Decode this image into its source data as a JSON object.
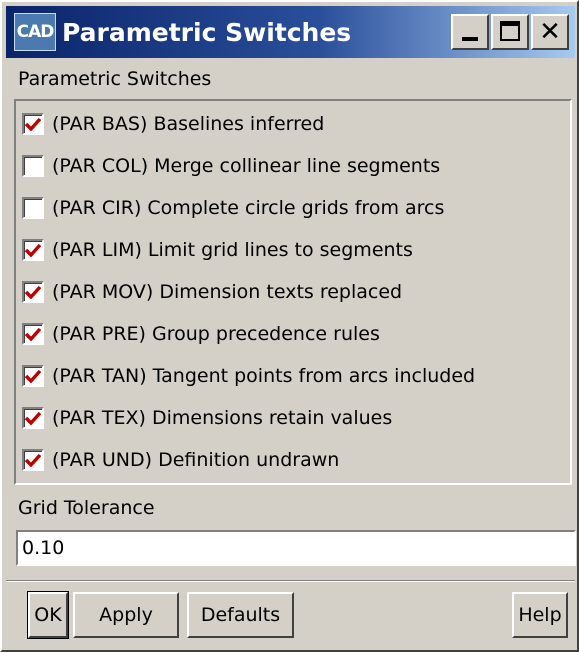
{
  "window": {
    "title": "Parametric Switches",
    "icon": "cad-icon",
    "icon_text": "CAD",
    "controls": [
      "minimize-icon",
      "maximize-icon",
      "close-icon"
    ],
    "close_glyph": "✕"
  },
  "switches_section": {
    "label": "Parametric Switches",
    "items": [
      {
        "label": "(PAR BAS) Baselines inferred",
        "checked": true
      },
      {
        "label": "(PAR COL) Merge collinear line segments",
        "checked": false
      },
      {
        "label": "(PAR CIR) Complete circle grids from arcs",
        "checked": false
      },
      {
        "label": "(PAR LIM) Limit grid lines to segments",
        "checked": true
      },
      {
        "label": "(PAR MOV) Dimension texts replaced",
        "checked": true
      },
      {
        "label": "(PAR PRE) Group precedence rules",
        "checked": true
      },
      {
        "label": "(PAR TAN) Tangent points from arcs included",
        "checked": true
      },
      {
        "label": "(PAR TEX) Dimensions retain values",
        "checked": true
      },
      {
        "label": "(PAR UND) Definition undrawn",
        "checked": true
      }
    ]
  },
  "grid_tolerance": {
    "label": "Grid Tolerance",
    "value": "0.10"
  },
  "buttons": {
    "ok": "OK",
    "apply": "Apply",
    "defaults": "Defaults",
    "help": "Help"
  },
  "colors": {
    "titlebar_start": "#0a246a",
    "titlebar_end": "#a6caf0",
    "face": "#d4d0c8",
    "check_mark": "#c00000"
  }
}
